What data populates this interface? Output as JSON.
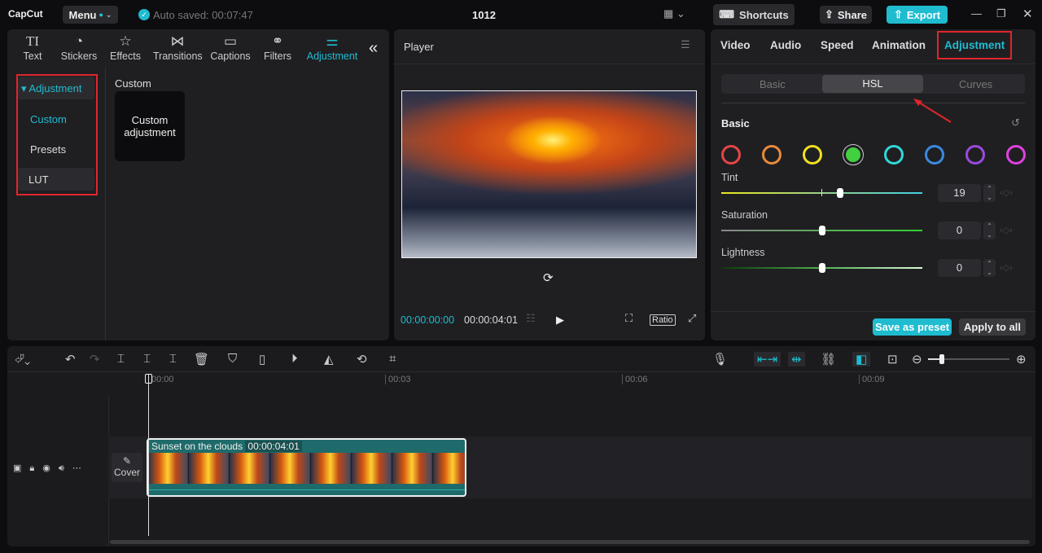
{
  "app": {
    "logo": "CapCut",
    "menu": "Menu",
    "autosave": "Auto saved: 00:07:47",
    "title": "1012",
    "shortcuts": "Shortcuts",
    "share": "Share",
    "export": "Export"
  },
  "toolbar": [
    {
      "label": "Text",
      "icon": "TI"
    },
    {
      "label": "Stickers",
      "icon": "◔"
    },
    {
      "label": "Effects",
      "icon": "☆"
    },
    {
      "label": "Transitions",
      "icon": "⋈"
    },
    {
      "label": "Captions",
      "icon": "▭"
    },
    {
      "label": "Filters",
      "icon": "⚭"
    },
    {
      "label": "Adjustment",
      "icon": "⚌"
    }
  ],
  "sidebar": {
    "header": "Adjustment",
    "items": [
      "Custom",
      "Presets",
      "LUT"
    ]
  },
  "content": {
    "section": "Custom",
    "card": "Custom adjustment"
  },
  "player": {
    "title": "Player",
    "current": "00:00:00:00",
    "total": "00:00:04:01",
    "ratio": "Ratio"
  },
  "right": {
    "tabs": [
      "Video",
      "Audio",
      "Speed",
      "Animation",
      "Adjustment"
    ],
    "subtabs": [
      "Basic",
      "HSL",
      "Curves"
    ],
    "section": "Basic",
    "hues": [
      "#e84545",
      "#e98a3a",
      "#f0e020",
      "#40d040",
      "#30d8d8",
      "#3a8ae0",
      "#9a4ae0",
      "#e040e0"
    ],
    "sliders": [
      {
        "label": "Tint",
        "value": "19",
        "fraction": 0.59
      },
      {
        "label": "Saturation",
        "value": "0",
        "fraction": 0.5
      },
      {
        "label": "Lightness",
        "value": "0",
        "fraction": 0.5
      }
    ],
    "save_preset": "Save as preset",
    "apply_all": "Apply to all"
  },
  "timeline": {
    "ticks": [
      "00:00",
      "00:03",
      "00:06",
      "00:09"
    ],
    "clip_name": "Sunset on the clouds",
    "clip_duration": "00:00:04:01",
    "cover": "Cover"
  }
}
